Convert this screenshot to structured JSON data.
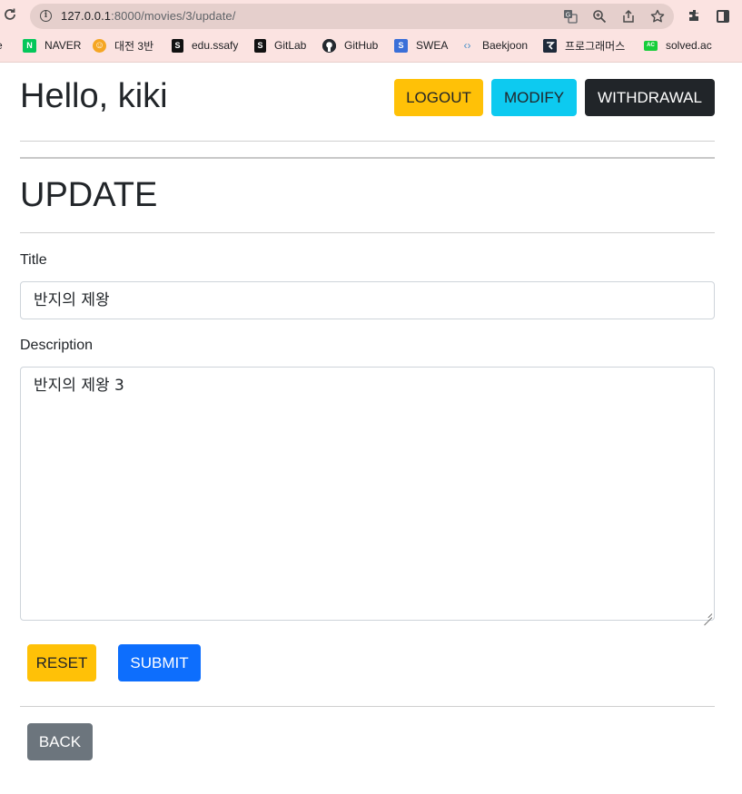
{
  "browser": {
    "url_host": "127.0.0.1",
    "url_path": ":8000/movies/3/update/",
    "icons": [
      "reload-icon",
      "info-icon",
      "translate-icon",
      "zoom-icon",
      "share-icon",
      "star-icon",
      "extensions-icon",
      "side-panel-icon"
    ],
    "bookmarks": [
      {
        "label": "NAVER",
        "icon": "naver-icon",
        "color": "#03c75a",
        "glyph": "N"
      },
      {
        "label": "대전 3반",
        "icon": "emoji-icon",
        "color": "#f5a623",
        "glyph": "☺"
      },
      {
        "label": "edu.ssafy",
        "icon": "ssafy-icon",
        "color": "#111111",
        "glyph": "S"
      },
      {
        "label": "GitLab",
        "icon": "gitlab-icon",
        "color": "#111111",
        "glyph": "S"
      },
      {
        "label": "GitHub",
        "icon": "github-icon",
        "color": "#24292f",
        "glyph": "●"
      },
      {
        "label": "SWEA",
        "icon": "swea-icon",
        "color": "#3a6fd8",
        "glyph": "S"
      },
      {
        "label": "Baekjoon",
        "icon": "code-icon",
        "color": "#ffffff",
        "glyph": "‹›"
      },
      {
        "label": "프로그래머스",
        "icon": "programmers-icon",
        "color": "#1e2a3a",
        "glyph": "⌁"
      },
      {
        "label": "solved.ac",
        "icon": "solvedac-icon",
        "color": "#17ce3a",
        "glyph": "AC"
      }
    ]
  },
  "header": {
    "greeting": "Hello, kiki",
    "logout_label": "LOGOUT",
    "modify_label": "MODIFY",
    "withdrawal_label": "WITHDRAWAL"
  },
  "form": {
    "heading": "UPDATE",
    "title_label": "Title",
    "title_value": "반지의 제왕",
    "description_label": "Description",
    "description_value": "반지의 제왕 3",
    "reset_label": "RESET",
    "submit_label": "SUBMIT"
  },
  "footer": {
    "back_label": "BACK"
  },
  "colors": {
    "warning": "#ffc107",
    "info": "#0dcaf0",
    "dark": "#212529",
    "primary": "#0d6efd",
    "secondary": "#6c757d",
    "chrome_bg": "#fbe3e1"
  }
}
